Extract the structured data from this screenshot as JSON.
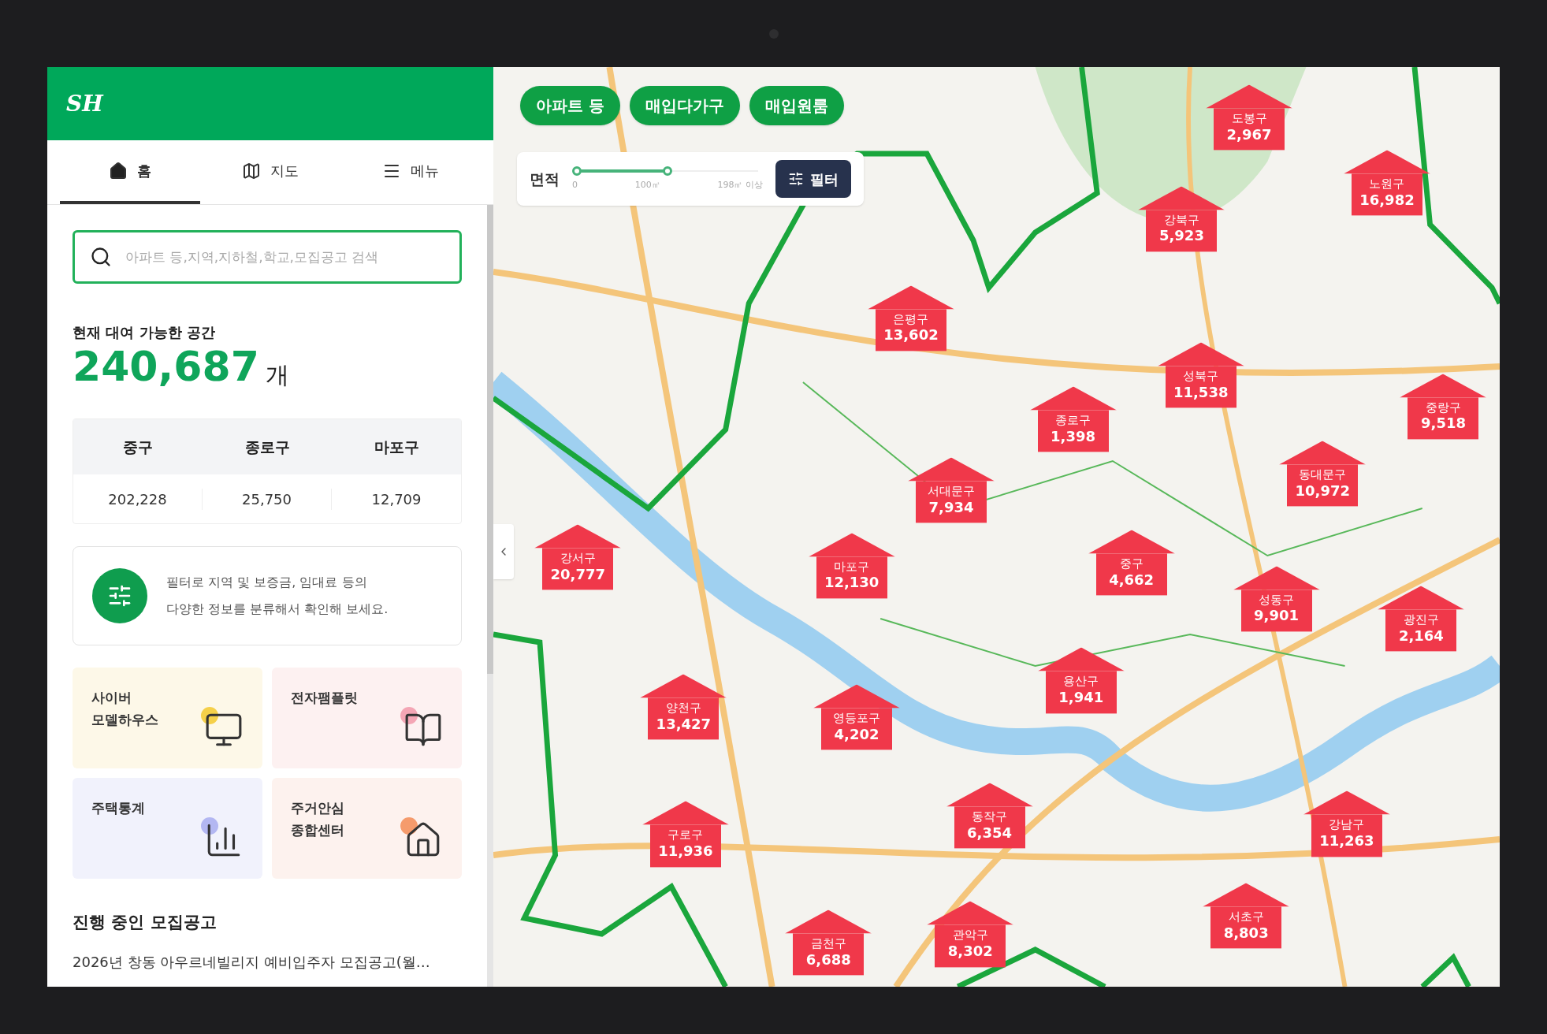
{
  "header": {
    "logo": "SH"
  },
  "tabs": [
    {
      "label": "홈",
      "selected": true
    },
    {
      "label": "지도",
      "selected": false
    },
    {
      "label": "메뉴",
      "selected": false
    }
  ],
  "search": {
    "placeholder": "아파트 등,지역,지하철,학교,모집공고 검색"
  },
  "available": {
    "title": "현재 대여 가능한 공간",
    "count": "240,687",
    "unit": "개"
  },
  "district_table": {
    "columns": [
      "중구",
      "종로구",
      "마포구"
    ],
    "values": [
      "202,228",
      "25,750",
      "12,709"
    ]
  },
  "filter_tip": {
    "text": "필터로 지역 및 보증금, 임대료 등의\n다양한 정보를 분류해서 확인해 보세요."
  },
  "tiles": [
    {
      "label": "사이버\n모델하우스",
      "kind": "monitor",
      "color": "#fdf8e8"
    },
    {
      "label": "전자팸플릿",
      "kind": "book",
      "color": "#fdf1f1"
    },
    {
      "label": "주택통계",
      "kind": "chart",
      "color": "#f1f2fc"
    },
    {
      "label": "주거안심\n종합센터",
      "kind": "house",
      "color": "#fdf2ee"
    }
  ],
  "notices": {
    "title": "진행 중인 모집공고",
    "items": [
      "2026년 창동 아우르네빌리지 예비입주자 모집공고(월…"
    ]
  },
  "map": {
    "chips": [
      "아파트 등",
      "매입다가구",
      "매입원룸"
    ],
    "area_filter": {
      "label": "면적",
      "level": 0.5,
      "ticks": [
        "0",
        "100㎡",
        "198㎡ 이상"
      ],
      "button": "필터"
    },
    "markers": [
      {
        "name": "도봉구",
        "count": "2,967"
      },
      {
        "name": "노원구",
        "count": "16,982"
      },
      {
        "name": "강북구",
        "count": "5,923"
      },
      {
        "name": "은평구",
        "count": "13,602"
      },
      {
        "name": "성북구",
        "count": "11,538"
      },
      {
        "name": "종로구",
        "count": "1,398"
      },
      {
        "name": "중랑구",
        "count": "9,518"
      },
      {
        "name": "동대문구",
        "count": "10,972"
      },
      {
        "name": "서대문구",
        "count": "7,934"
      },
      {
        "name": "강서구",
        "count": "20,777"
      },
      {
        "name": "마포구",
        "count": "12,130"
      },
      {
        "name": "중구",
        "count": "4,662"
      },
      {
        "name": "성동구",
        "count": "9,901"
      },
      {
        "name": "광진구",
        "count": "2,164"
      },
      {
        "name": "용산구",
        "count": "1,941"
      },
      {
        "name": "양천구",
        "count": "13,427"
      },
      {
        "name": "영등포구",
        "count": "4,202"
      },
      {
        "name": "동작구",
        "count": "6,354"
      },
      {
        "name": "강남구",
        "count": "11,263"
      },
      {
        "name": "구로구",
        "count": "11,936"
      },
      {
        "name": "서초구",
        "count": "8,803"
      },
      {
        "name": "관악구",
        "count": "8,302"
      },
      {
        "name": "금천구",
        "count": "6,688"
      }
    ]
  }
}
